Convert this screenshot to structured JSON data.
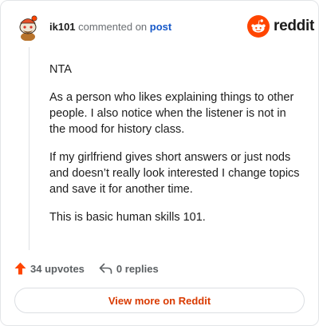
{
  "comment": {
    "username": "ik101",
    "action_text": "commented on",
    "post_link_text": "post",
    "paragraphs": [
      "NTA",
      "As a person who likes explaining things to other people. I also notice when the listener is not in the mood for history class.",
      "If my girlfriend gives short answers or just nods and doesn’t really look interested I change topics and save it for another time.",
      "This is basic human skills 101."
    ],
    "upvotes_label": "34 upvotes",
    "replies_label": "0 replies"
  },
  "brand": {
    "name": "reddit",
    "color": "#ff4500",
    "icon": "reddit-snoo-icon"
  },
  "view_more_label": "View more on Reddit",
  "colors": {
    "accent": "#ff4500",
    "link": "#1658c8",
    "view_more_text": "#d93a00"
  },
  "icons": {
    "avatar": "avatar-icon",
    "upvote": "upvote-arrow-icon",
    "reply": "reply-arrow-icon"
  }
}
